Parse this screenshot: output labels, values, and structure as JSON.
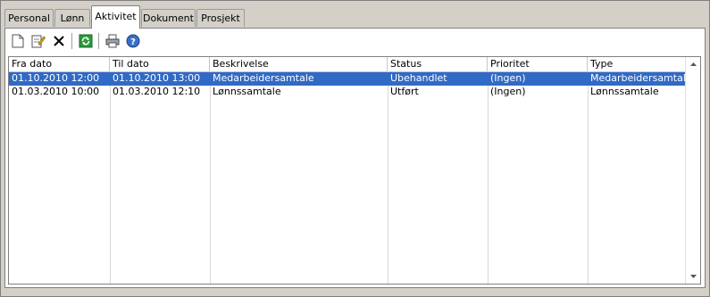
{
  "tabs": [
    {
      "label": "Personal",
      "active": false
    },
    {
      "label": "Lønn",
      "active": false
    },
    {
      "label": "Aktivitet",
      "active": true
    },
    {
      "label": "Dokument",
      "active": false
    },
    {
      "label": "Prosjekt",
      "active": false
    }
  ],
  "toolbar": {
    "buttons": [
      "new-document-icon",
      "edit-icon",
      "delete-icon",
      "refresh-icon",
      "print-icon",
      "help-icon"
    ]
  },
  "grid": {
    "columns": [
      "Fra dato",
      "Til dato",
      "Beskrivelse",
      "Status",
      "Prioritet",
      "Type"
    ],
    "rows": [
      {
        "selected": true,
        "cells": [
          "01.10.2010 12:00",
          "01.10.2010 13:00",
          "Medarbeidersamtale",
          "Ubehandlet",
          "(Ingen)",
          "Medarbeidersamtale"
        ]
      },
      {
        "selected": false,
        "cells": [
          "01.03.2010 10:00",
          "01.03.2010 12:10",
          "Lønnssamtale",
          "Utført",
          "(Ingen)",
          "Lønnssamtale"
        ]
      }
    ]
  },
  "colors": {
    "selection": "#316ac5",
    "window": "#d4d0c8"
  }
}
